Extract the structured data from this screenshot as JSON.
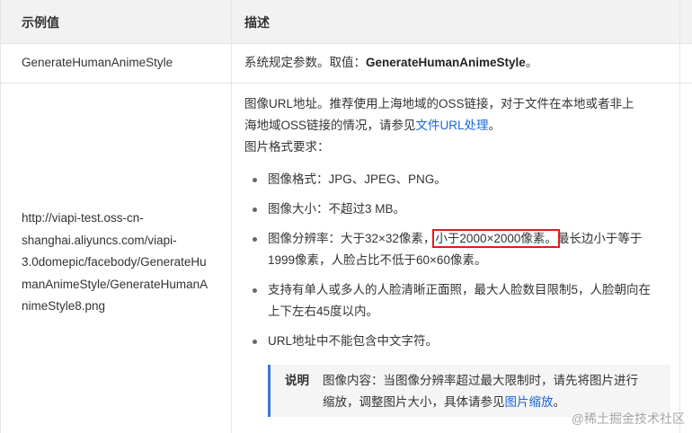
{
  "header": {
    "col_example": "示例值",
    "col_desc": "描述"
  },
  "row1": {
    "example": "GenerateHumanAnimeStyle",
    "desc_prefix": "系统规定参数。取值：",
    "desc_bold": "GenerateHumanAnimeStyle",
    "desc_suffix": "。"
  },
  "row2": {
    "example_lines": [
      "http://viapi-test.oss-cn-",
      "shanghai.aliyuncs.com/viapi-",
      "3.0domepic/facebody/GenerateHu",
      "manAnimeStyle/GenerateHumanA",
      "nimeStyle8.png"
    ],
    "intro_line1": "图像URL地址。推荐使用上海地域的OSS链接，对于文件在本地或者非上",
    "intro_line2_prefix": "海地域OSS链接的情况，请参见",
    "intro_link": "文件URL处理",
    "intro_line2_suffix": "。",
    "format_title": "图片格式要求：",
    "items": {
      "format": "图像格式：JPG、JPEG、PNG。",
      "size": "图像大小：不超过3 MB。",
      "res_prefix": "图像分辨率：大于32×32像素，",
      "res_highlight": "小于2000×2000像素。",
      "res_suffix": "最长边小于等于",
      "res_line2": "1999像素，人脸占比不低于60×60像素。",
      "face_line1": "支持有单人或多人的人脸清晰正面照，最大人脸数目限制5，人脸朝向在",
      "face_line2": "上下左右45度以内。",
      "url": "URL地址中不能包含中文字符。"
    },
    "note": {
      "label": "说明",
      "line1": "图像内容：当图像分辨率超过最大限制时，请先将图片进行",
      "line2_prefix": "缩放，调整图片大小，具体请参见",
      "line2_link": "图片缩放",
      "line2_suffix": "。"
    }
  },
  "watermark": "@稀土掘金技术社区",
  "colors": {
    "link": "#1a66d8",
    "highlight_border": "#e01c1c",
    "note_bar": "#3a76d9"
  }
}
